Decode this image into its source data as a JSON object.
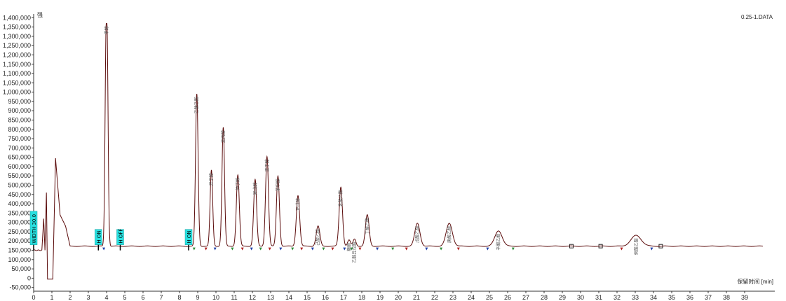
{
  "header": {
    "filename": "0.25-1.DATA",
    "y_unit_label": "强"
  },
  "chart_data": {
    "type": "line",
    "title": "",
    "xlabel": "保留时间 [min]",
    "ylabel": "强",
    "xlim": [
      0,
      40
    ],
    "ylim": [
      -70000,
      1420000
    ],
    "x_ticks": [
      0,
      1,
      2,
      3,
      4,
      5,
      6,
      7,
      8,
      9,
      10,
      11,
      12,
      13,
      14,
      15,
      16,
      17,
      18,
      19,
      20,
      21,
      22,
      23,
      24,
      25,
      26,
      27,
      28,
      29,
      30,
      31,
      32,
      33,
      34,
      35,
      36,
      37,
      38,
      39
    ],
    "y_ticks": [
      -50000,
      0,
      50000,
      100000,
      150000,
      200000,
      250000,
      300000,
      350000,
      400000,
      450000,
      500000,
      550000,
      600000,
      650000,
      700000,
      750000,
      800000,
      850000,
      900000,
      950000,
      1000000,
      1050000,
      1100000,
      1150000,
      1200000,
      1250000,
      1300000,
      1350000,
      1400000
    ],
    "y_tick_labels": [
      "-50,000",
      "0",
      "50,000",
      "100,000",
      "150,000",
      "200,000",
      "250,000",
      "300,000",
      "350,000",
      "400,000",
      "450,000",
      "500,000",
      "550,000",
      "600,000",
      "650,000",
      "700,000",
      "750,000",
      "800,000",
      "850,000",
      "900,000",
      "950,000",
      "1,000,000",
      "1,050,000",
      "1,100,000",
      "1,150,000",
      "1,200,000",
      "1,250,000",
      "1,300,000",
      "1,350,000",
      "1,400,000"
    ],
    "baseline": 172000,
    "series_color": "#5a0a0a",
    "peaks": [
      {
        "label": "甲醇",
        "rt": 4.0,
        "height": 1370000,
        "width": 0.06,
        "flat_top": true
      },
      {
        "label": "乙酸乙酯",
        "rt": 8.95,
        "height": 990000,
        "width": 0.07
      },
      {
        "label": "异丁醇",
        "rt": 9.75,
        "height": 580000,
        "width": 0.07
      },
      {
        "label": "正丙醇",
        "rt": 10.4,
        "height": 810000,
        "width": 0.07
      },
      {
        "label": "仲丁醇",
        "rt": 11.2,
        "height": 555000,
        "width": 0.08
      },
      {
        "label": "异戊醇",
        "rt": 12.15,
        "height": 530000,
        "width": 0.08
      },
      {
        "label": "正丁醇",
        "rt": 12.8,
        "height": 655000,
        "width": 0.08
      },
      {
        "label": "苯甲醇",
        "rt": 13.4,
        "height": 550000,
        "width": 0.08
      },
      {
        "label": "正戊醇",
        "rt": 14.5,
        "height": 445000,
        "width": 0.09
      },
      {
        "label": "己酸乙酯",
        "rt": 15.6,
        "height": 280000,
        "width": 0.1
      },
      {
        "label": "乳酸乙酯",
        "rt": 16.85,
        "height": 490000,
        "width": 0.09
      },
      {
        "label": "糠醛",
        "rt": 17.3,
        "height": 205000,
        "width": 0.08
      },
      {
        "label": "乙酸异戊酯",
        "rt": 17.6,
        "height": 210000,
        "width": 0.08
      },
      {
        "label": "丁酸乙酯",
        "rt": 18.3,
        "height": 340000,
        "width": 0.1
      },
      {
        "label": "戊酸乙酯",
        "rt": 21.05,
        "height": 295000,
        "width": 0.14
      },
      {
        "label": "庚酸乙酯",
        "rt": 22.8,
        "height": 295000,
        "width": 0.17
      },
      {
        "label": "辛酸乙酯",
        "rt": 25.5,
        "height": 255000,
        "width": 0.2
      },
      {
        "label": "癸酸乙酯",
        "rt": 33.05,
        "height": 230000,
        "width": 0.28
      }
    ],
    "event_markers": [
      {
        "label": "WIDTH 30.0",
        "t": 0.0
      },
      {
        "label": "H ON",
        "t": 3.55
      },
      {
        "label": "H OFF",
        "t": 4.75
      },
      {
        "label": "H ON",
        "t": 8.5
      }
    ],
    "open_markers": [
      29.5,
      31.1,
      34.4
    ],
    "integration_markers": [
      3.85,
      8.8,
      9.45,
      9.95,
      10.9,
      11.45,
      11.95,
      12.45,
      12.95,
      13.55,
      14.2,
      14.7,
      15.3,
      15.9,
      16.4,
      17.05,
      17.45,
      17.9,
      18.85,
      19.7,
      20.45,
      21.55,
      22.35,
      23.3,
      24.9,
      26.3,
      32.25,
      33.9
    ]
  }
}
